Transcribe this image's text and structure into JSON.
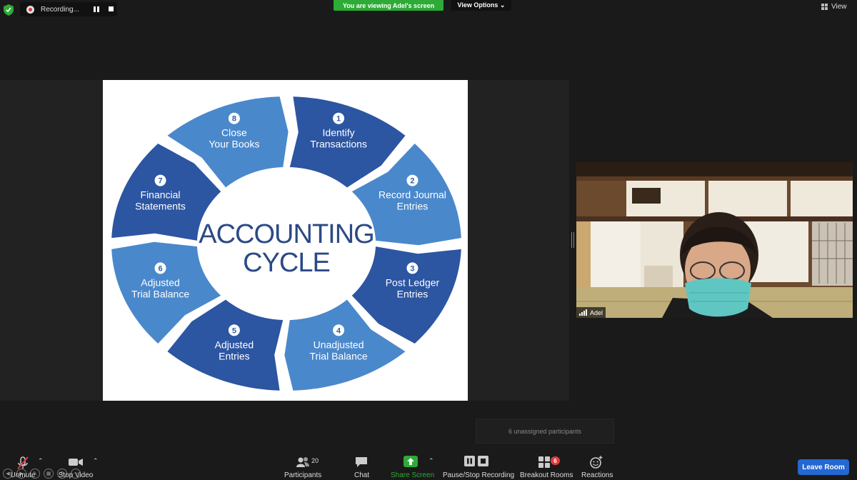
{
  "recording": {
    "label": "Recording..."
  },
  "banner": {
    "viewing": "You are viewing Adel's screen",
    "view_options": "View Options ⌄"
  },
  "view": {
    "label": "View"
  },
  "slide": {
    "title_line1": "ACCOUNTING",
    "title_line2": "CYCLE",
    "colors": {
      "dark": "#2c55a2",
      "light": "#4a88cc",
      "ink": "#2b4a86"
    },
    "steps": [
      {
        "num": "1",
        "line1": "Identify",
        "line2": "Transactions"
      },
      {
        "num": "2",
        "line1": "Record Journal",
        "line2": "Entries"
      },
      {
        "num": "3",
        "line1": "Post Ledger",
        "line2": "Entries"
      },
      {
        "num": "4",
        "line1": "Unadjusted",
        "line2": "Trial Balance"
      },
      {
        "num": "5",
        "line1": "Adjusted",
        "line2": "Entries"
      },
      {
        "num": "6",
        "line1": "Adjusted",
        "line2": "Trial Balance"
      },
      {
        "num": "7",
        "line1": "Financial",
        "line2": "Statements"
      },
      {
        "num": "8",
        "line1": "Close",
        "line2": "Your Books"
      }
    ]
  },
  "video": {
    "name": "Adel"
  },
  "breakout": {
    "unassigned": "6 unassigned participants",
    "badge": "6"
  },
  "toolbar": {
    "unmute": "Unmute",
    "stop_video": "Stop Video",
    "participants": "Participants",
    "participant_count": "20",
    "chat": "Chat",
    "share_screen": "Share Screen",
    "pause_stop_recording": "Pause/Stop Recording",
    "breakout_rooms": "Breakout Rooms",
    "reactions": "Reactions",
    "leave": "Leave Room"
  },
  "accent": {
    "green": "#2dab36",
    "blue": "#2468d1",
    "red": "#e03b3b"
  }
}
